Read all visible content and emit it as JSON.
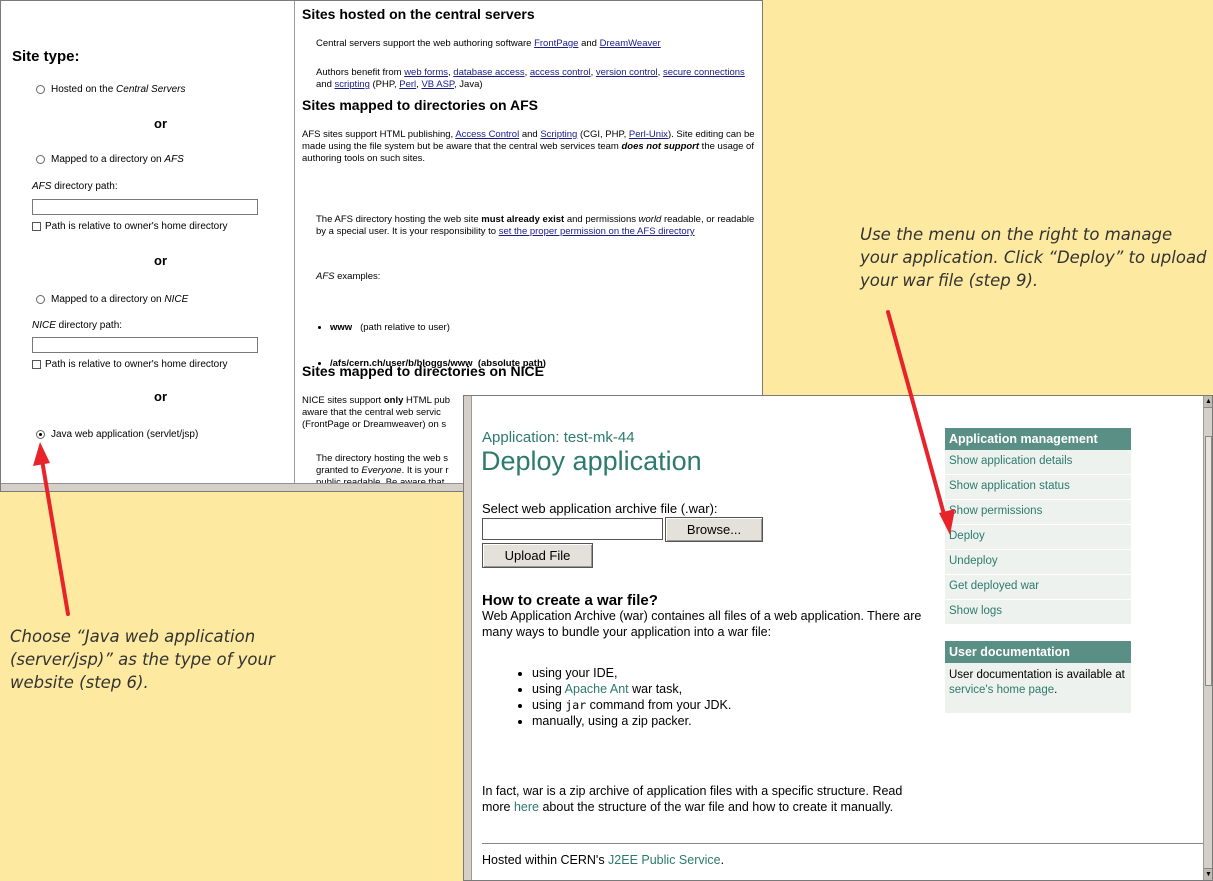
{
  "site_form": {
    "heading": "Site type:",
    "option_central_prefix": "Hosted on the ",
    "option_central_em": "Central Servers",
    "or1": "or",
    "option_afs_prefix": "Mapped to a directory on ",
    "option_afs_em": "AFS",
    "afs_path_label_em": "AFS",
    "afs_path_label_rest": " directory path:",
    "afs_relative": "Path is relative to owner's home directory",
    "or2": "or",
    "option_nice_prefix": "Mapped to a directory on ",
    "option_nice_em": "NICE",
    "nice_path_label_em": "NICE",
    "nice_path_label_rest": " directory path:",
    "nice_relative": "Path is relative to owner's home directory",
    "or3": "or",
    "option_java": "Java web application (servlet/jsp)",
    "selected_option": "java"
  },
  "site_info": {
    "central_title": "Sites hosted on the central servers",
    "central_p1_a": "Central servers support the web authoring software ",
    "central_link_frontpage": "FrontPage",
    "central_p1_and": " and ",
    "central_link_dreamweaver": "DreamWeaver",
    "central_p2_a": "Authors benefit from ",
    "link_web_forms": "web forms",
    "link_database_access": "database access",
    "link_access_control": "access control",
    "link_version_control": "version control",
    "link_secure_connections": "secure connections",
    "central_p2_and": " and ",
    "link_scripting": "scripting",
    "central_p2_php": " (PHP, ",
    "link_perl": "Perl",
    "link_vbasp": "VB ASP",
    "central_p2_java": ", Java)",
    "afs_title": "Sites mapped to directories on AFS",
    "afs_p1_a": "AFS sites support HTML publishing, ",
    "link_afs_access_control": "Access Control",
    "afs_p1_and": " and ",
    "link_afs_scripting": "Scripting",
    "afs_p1_cgi": " (CGI, PHP, ",
    "link_perl_unix": "Perl-Unix",
    "afs_p1_b": "). Site editing can be made using the file system but be aware that the central web services team ",
    "afs_p1_bold": "does not support",
    "afs_p1_c": " the usage of authoring tools on such sites.",
    "afs_p2_a": "The AFS directory hosting the web site ",
    "afs_p2_bold": "must already exist",
    "afs_p2_b": " and permissions ",
    "afs_p2_em": "world",
    "afs_p2_c": " readable, or readable by a special user. It is your responsibility to ",
    "link_set_permission": "set the proper permission on the AFS directory",
    "afs_examples_em": "AFS",
    "afs_examples_rest": " examples:",
    "ex1_bold": "www",
    "ex1_rest": "   (path relative to user)",
    "ex2_bold": "/afs/cern.ch/user/b/bloggs/www",
    "ex2_rest": "  (absolute path)",
    "nice_title": "Sites mapped to directories on NICE",
    "nice_p1_a": "NICE sites support ",
    "nice_p1_bold": "only",
    "nice_p1_b": " HTML pub",
    "nice_p1_line2": "aware that the central web servic",
    "nice_p1_line3": "(FrontPage or Dreamweaver) on s",
    "nice_p2_line1": "The directory hosting the web s",
    "nice_p2_line2_a": "granted to ",
    "nice_p2_line2_em": "Everyone",
    "nice_p2_line2_b": ". It is your r",
    "nice_p2_line3": "public readable. Be aware that"
  },
  "deploy": {
    "app_label": "Application: test-mk-44",
    "title": "Deploy application",
    "select_label": "Select web application archive file (.war):",
    "file_value": "",
    "browse_button": "Browse...",
    "upload_button": "Upload File",
    "howto_title": "How to create a war file?",
    "howto_p": "Web Application Archive (war) containes all files of a web application. There are many ways to bundle your application into a war file:",
    "list_1": "using your IDE,",
    "list_2_a": "using ",
    "list_2_link": "Apache Ant",
    "list_2_b": " war task,",
    "list_3_a": "using ",
    "list_3_code": "jar",
    "list_3_b": " command from your JDK.",
    "list_4": "manually, using a zip packer.",
    "fact_a": "In fact, war is a zip archive of application files with a specific structure. Read more ",
    "fact_link": "here",
    "fact_b": " about the structure of the war file and how to create it manually.",
    "footer_a": "Hosted within CERN's ",
    "footer_link": "J2EE Public Service",
    "footer_b": "."
  },
  "menu": {
    "header": "Application management",
    "items": [
      "Show application details",
      "Show application status",
      "Show permissions",
      "Deploy",
      "Undeploy",
      "Get deployed war",
      "Show logs"
    ],
    "doc_header": "User documentation",
    "doc_text_a": "User documentation is available at ",
    "doc_link": "service's home page",
    "doc_text_b": "."
  },
  "captions": {
    "right": "Use the menu on the right to manage your application. Click “Deploy” to upload your war file (step 9).",
    "left": "Choose “Java web application (server/jsp)” as the type of your website (step 6)."
  },
  "colors": {
    "background": "#fdeaa0",
    "accent": "#2d7a6e",
    "menu_header": "#5a8f86",
    "arrow": "#e8242b"
  }
}
